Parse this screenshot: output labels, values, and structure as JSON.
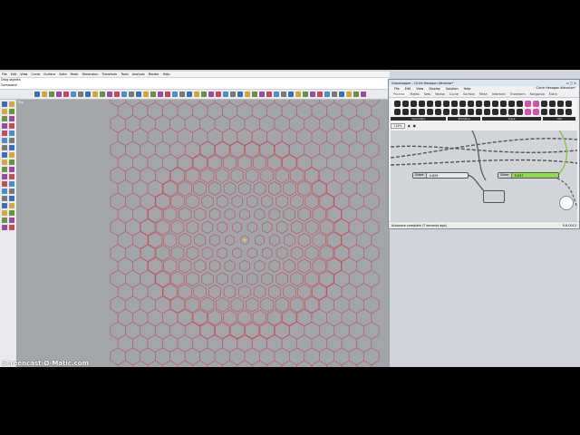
{
  "rhino": {
    "menu": [
      "File",
      "Edit",
      "View",
      "Curve",
      "Surface",
      "Solid",
      "Mesh",
      "Dimension",
      "Transform",
      "Tools",
      "Analysis",
      "Render",
      "Help"
    ],
    "cmd_history": "Drag objects",
    "cmd_prompt": "Command:",
    "viewport_label": "Top"
  },
  "grasshopper": {
    "title": "Grasshopper - Circle Hexagon Attractor*",
    "menu": [
      "File",
      "Edit",
      "View",
      "Display",
      "Solution",
      "Help"
    ],
    "doc_name": "Circle Hexagon Attractor*",
    "tabs": [
      "Params",
      "Maths",
      "Sets",
      "Vector",
      "Curve",
      "Surface",
      "Mesh",
      "Intersect",
      "Transform",
      "Kangaroo",
      "Extra"
    ],
    "categories": [
      "Geometry",
      "Primitive",
      "Input",
      "Util"
    ],
    "zoom": "116%",
    "slider1_label": "Slider",
    "slider1_value": "0.829",
    "slider2_label": "Slider",
    "slider2_value": "5.057",
    "status": "Autosave complete (7 seconds ago)",
    "version": "0.8.0013"
  },
  "watermark": "Screencast-O-Matic.com",
  "colors": {
    "hex_lines": "#c44a57",
    "viewport": "#a2a5a9",
    "gh_wire": "#8fc44a"
  }
}
